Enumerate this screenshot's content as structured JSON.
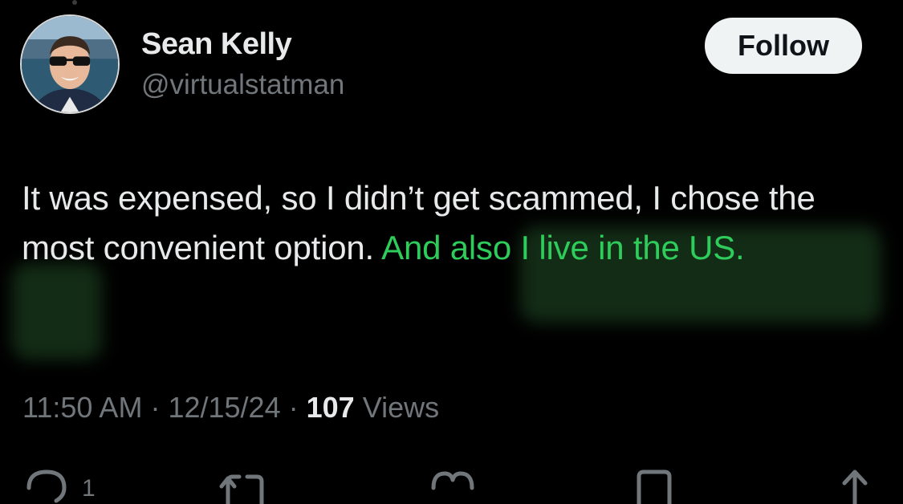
{
  "author": {
    "display_name": "Sean Kelly",
    "handle": "@virtualstatman"
  },
  "follow_button": {
    "label": "Follow"
  },
  "tweet": {
    "text_plain": "It was expensed, so I didn’t get scammed, I chose the most convenient option.  ",
    "text_highlighted": "And also I live in the US.",
    "highlight_color": "#2ecc5b"
  },
  "meta": {
    "time": "11:50 AM",
    "separator": "·",
    "date": "12/15/24",
    "views_count": "107",
    "views_label": "Views"
  },
  "actions": {
    "reply_icon": "reply-icon",
    "reply_count": "1",
    "retweet_icon": "retweet-icon",
    "like_icon": "heart-icon",
    "bookmark_icon": "bookmark-icon",
    "share_icon": "share-icon"
  }
}
